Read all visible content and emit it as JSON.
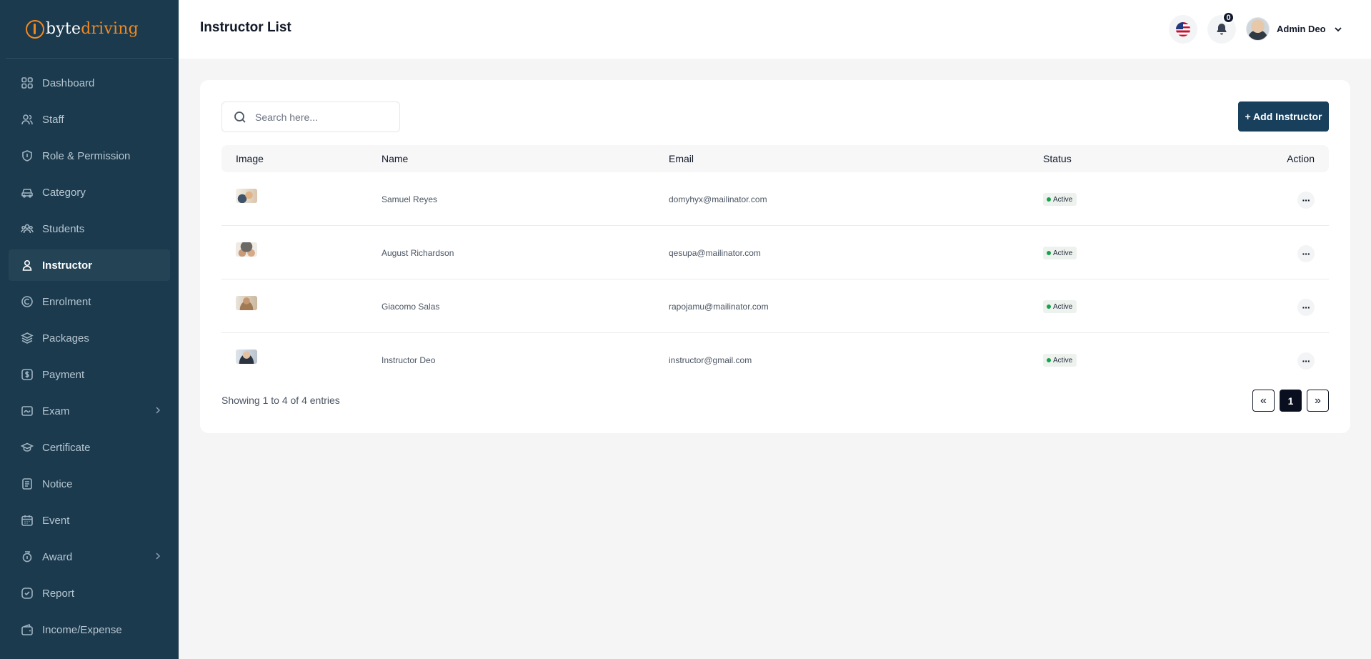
{
  "brand": {
    "prefix": "byte",
    "accent": "driving"
  },
  "sidebar": {
    "items": [
      {
        "key": "dashboard",
        "label": "Dashboard",
        "icon": "grid-icon",
        "active": false,
        "chevron": false
      },
      {
        "key": "staff",
        "label": "Staff",
        "icon": "users-icon",
        "active": false,
        "chevron": false
      },
      {
        "key": "role",
        "label": "Role & Permission",
        "icon": "shield-icon",
        "active": false,
        "chevron": false
      },
      {
        "key": "category",
        "label": "Category",
        "icon": "car-icon",
        "active": false,
        "chevron": false
      },
      {
        "key": "students",
        "label": "Students",
        "icon": "group-icon",
        "active": false,
        "chevron": false
      },
      {
        "key": "instructor",
        "label": "Instructor",
        "icon": "user-icon",
        "active": true,
        "chevron": false
      },
      {
        "key": "enrolment",
        "label": "Enrolment",
        "icon": "enrol-icon",
        "active": false,
        "chevron": false
      },
      {
        "key": "packages",
        "label": "Packages",
        "icon": "layers-icon",
        "active": false,
        "chevron": false
      },
      {
        "key": "payment",
        "label": "Payment",
        "icon": "dollar-icon",
        "active": false,
        "chevron": false
      },
      {
        "key": "exam",
        "label": "Exam",
        "icon": "exam-icon",
        "active": false,
        "chevron": true
      },
      {
        "key": "certificate",
        "label": "Certificate",
        "icon": "graduation-icon",
        "active": false,
        "chevron": false
      },
      {
        "key": "notice",
        "label": "Notice",
        "icon": "notice-icon",
        "active": false,
        "chevron": false
      },
      {
        "key": "event",
        "label": "Event",
        "icon": "calendar-icon",
        "active": false,
        "chevron": false
      },
      {
        "key": "award",
        "label": "Award",
        "icon": "award-icon",
        "active": false,
        "chevron": true
      },
      {
        "key": "report",
        "label": "Report",
        "icon": "report-icon",
        "active": false,
        "chevron": false
      },
      {
        "key": "income",
        "label": "Income/Expense",
        "icon": "wallet-icon",
        "active": false,
        "chevron": false
      }
    ]
  },
  "header": {
    "title": "Instructor List",
    "notification_count": "0",
    "user_name": "Admin Deo"
  },
  "search": {
    "placeholder": "Search here..."
  },
  "add_button": "+ Add Instructor",
  "table": {
    "columns": [
      "Image",
      "Name",
      "Email",
      "Status",
      "Action"
    ],
    "rows": [
      {
        "name": "Samuel Reyes",
        "email": "domyhyx@mailinator.com",
        "status": "Active"
      },
      {
        "name": "August Richardson",
        "email": "qesupa@mailinator.com",
        "status": "Active"
      },
      {
        "name": "Giacomo Salas",
        "email": "rapojamu@mailinator.com",
        "status": "Active"
      },
      {
        "name": "Instructor Deo",
        "email": "instructor@gmail.com",
        "status": "Active"
      }
    ]
  },
  "footer": {
    "showing": "Showing 1 to 4 of 4 entries"
  },
  "pagination": {
    "prev": "«",
    "current": "1",
    "next": "»"
  },
  "colors": {
    "sidebar": "#1b3a4e",
    "accent": "#f2891f",
    "primary_button": "#183f5c",
    "status_dot": "#16a34a"
  }
}
